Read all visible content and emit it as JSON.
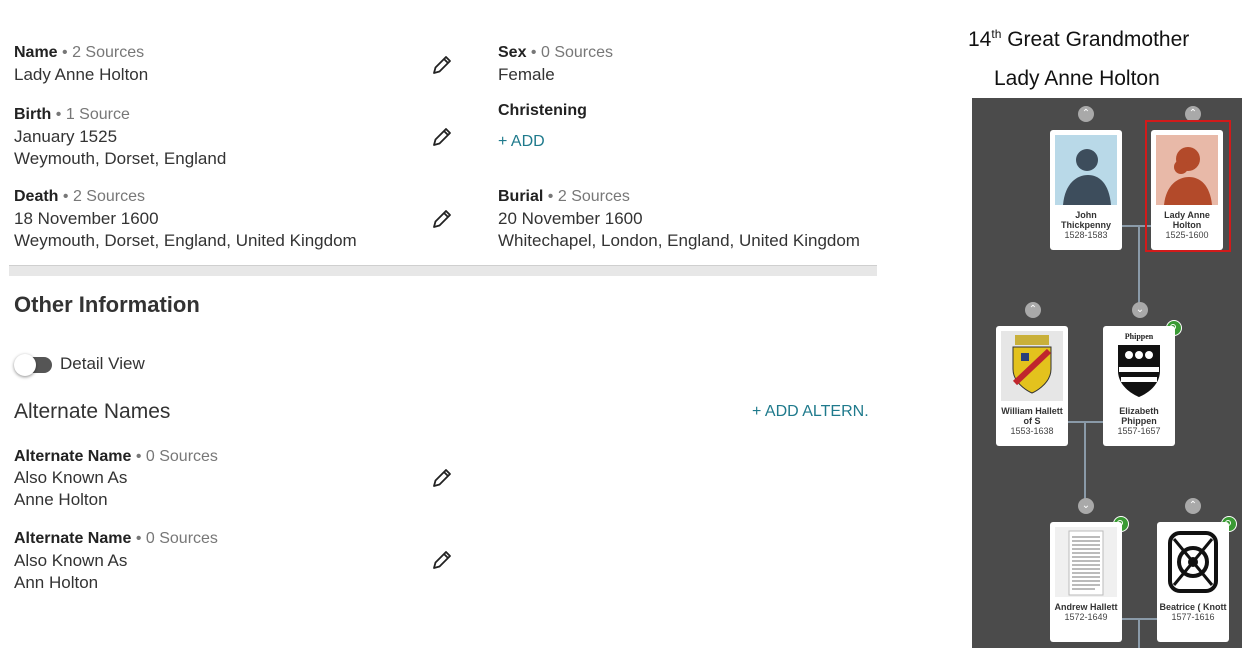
{
  "facts": {
    "name": {
      "label": "Name",
      "sources": "• 2 Sources",
      "value": "Lady Anne Holton"
    },
    "sex": {
      "label": "Sex",
      "sources": "• 0 Sources",
      "value": "Female"
    },
    "birth": {
      "label": "Birth",
      "sources": "• 1 Source",
      "date": "January 1525",
      "place": "Weymouth, Dorset, England"
    },
    "christening": {
      "label": "Christening",
      "add": "+  ADD"
    },
    "death": {
      "label": "Death",
      "sources": "• 2 Sources",
      "date": "18 November 1600",
      "place": "Weymouth, Dorset, England, United Kingdom"
    },
    "burial": {
      "label": "Burial",
      "sources": "• 2 Sources",
      "date": "20 November 1600",
      "place": "Whitechapel, London, England, United Kingdom"
    }
  },
  "other": {
    "title": "Other Information",
    "detail_view": "Detail View",
    "alternate_names_title": "Alternate Names",
    "add_alternate": "+  ADD ALTERN.",
    "alternates": [
      {
        "label": "Alternate Name",
        "sources": "• 0 Sources",
        "type": "Also Known As",
        "value": "Anne Holton"
      },
      {
        "label": "Alternate Name",
        "sources": "• 0 Sources",
        "type": "Also Known As",
        "value": "Ann Holton"
      }
    ]
  },
  "caption": {
    "relation_prefix": "14",
    "relation_sup": "th",
    "relation_suffix": " Great Grandmother",
    "name": "Lady Anne Holton"
  },
  "tree": {
    "people": [
      {
        "name": "John Thickpenny",
        "dates": "1528-1583"
      },
      {
        "name": "Lady Anne Holton",
        "dates": "1525-1600"
      },
      {
        "name": "William Hallett of S",
        "dates": "1553-1638"
      },
      {
        "name": "Elizabeth Phippen",
        "dates": "1557-1657",
        "crest_text": "Phippen"
      },
      {
        "name": "Andrew Hallett",
        "dates": "1572-1649"
      },
      {
        "name": "Beatrice ( Knott",
        "dates": "1577-1616"
      }
    ],
    "colors": {
      "background": "#4b4b4b",
      "highlight": "#d11a1a",
      "male_avatar": "#b9d9e8",
      "female_avatar": "#e8b9a8",
      "hint_leaf": "#3a9a34"
    }
  }
}
